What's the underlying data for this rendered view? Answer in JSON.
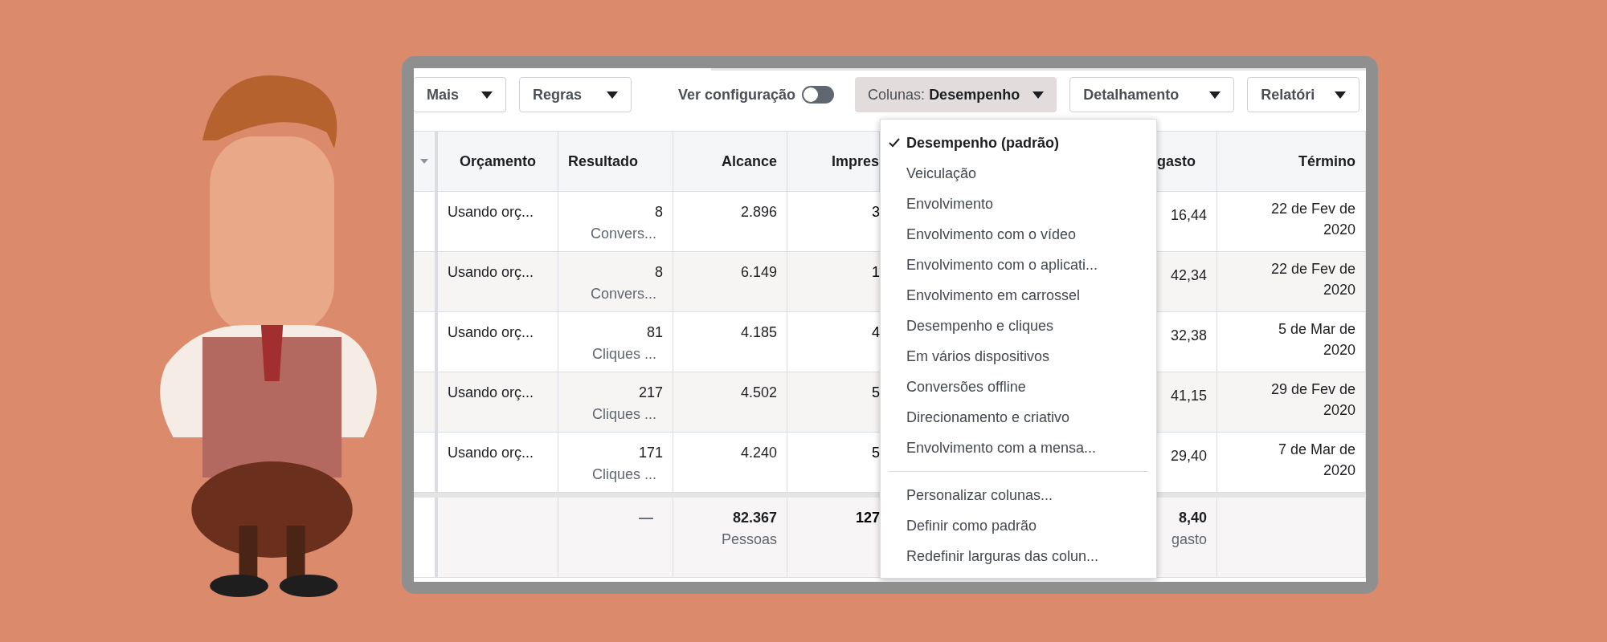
{
  "toolbar": {
    "buttons": [
      {
        "label": "Mais"
      },
      {
        "label": "Regras"
      }
    ],
    "view_setting": {
      "label": "Ver configuração",
      "on": false
    },
    "columns_button": {
      "prefix": "Colunas:",
      "value": "Desempenho",
      "expanded": true
    },
    "more_buttons": [
      {
        "label": "Detalhamento"
      },
      {
        "label": "Relatóri"
      }
    ]
  },
  "table": {
    "columns": [
      "Orçamento",
      "Resultado",
      "Alcance",
      "Impres",
      "gasto",
      "Término"
    ],
    "rows": [
      {
        "budget": "Usando orç...",
        "result": "8",
        "result_type": "Convers...",
        "reach": "2.896",
        "column_5": "3",
        "column_6": "16,44",
        "end": "22 de Fev de 2020"
      },
      {
        "budget": "Usando orç...",
        "result": "8",
        "result_type": "Convers...",
        "reach": "6.149",
        "column_5": "1",
        "column_6": "42,34",
        "end": "22 de Fev de 2020"
      },
      {
        "budget": "Usando orç...",
        "result": "81",
        "result_type": "Cliques ...",
        "reach": "4.185",
        "column_5": "4",
        "column_6": "32,38",
        "end": "5 de Mar de 2020"
      },
      {
        "budget": "Usando orç...",
        "result": "217",
        "result_type": "Cliques ...",
        "reach": "4.502",
        "column_5": "5",
        "column_6": "41,15",
        "end": "29 de Fev de 2020"
      },
      {
        "budget": "Usando orç...",
        "result": "171",
        "result_type": "Cliques ...",
        "reach": "4.240",
        "column_5": "5",
        "column_6": "29,40",
        "end": "7 de Mar de 2020"
      }
    ],
    "totals": {
      "result": "—",
      "reach": "82.367",
      "reach_unit": "Pessoas",
      "column_5": "127",
      "column_6": "8,40",
      "column_6_unit": "gasto"
    }
  },
  "menu": {
    "items": [
      {
        "label": "Desempenho (padrão)",
        "checked": true
      },
      {
        "label": "Veiculação",
        "checked": false
      },
      {
        "label": "Envolvimento",
        "checked": false
      },
      {
        "label": "Envolvimento com o vídeo",
        "checked": false
      },
      {
        "label": "Envolvimento com o aplicati...",
        "checked": false
      },
      {
        "label": "Envolvimento em carrossel",
        "checked": false
      },
      {
        "label": "Desempenho e cliques",
        "checked": false
      },
      {
        "label": "Em vários dispositivos",
        "checked": false
      },
      {
        "label": "Conversões offline",
        "checked": false
      },
      {
        "label": "Direcionamento e criativo",
        "checked": false
      },
      {
        "label": "Envolvimento com a mensa...",
        "checked": false
      }
    ],
    "actions": [
      "Personalizar colunas...",
      "Definir como padrão",
      "Redefinir larguras das colun..."
    ]
  }
}
